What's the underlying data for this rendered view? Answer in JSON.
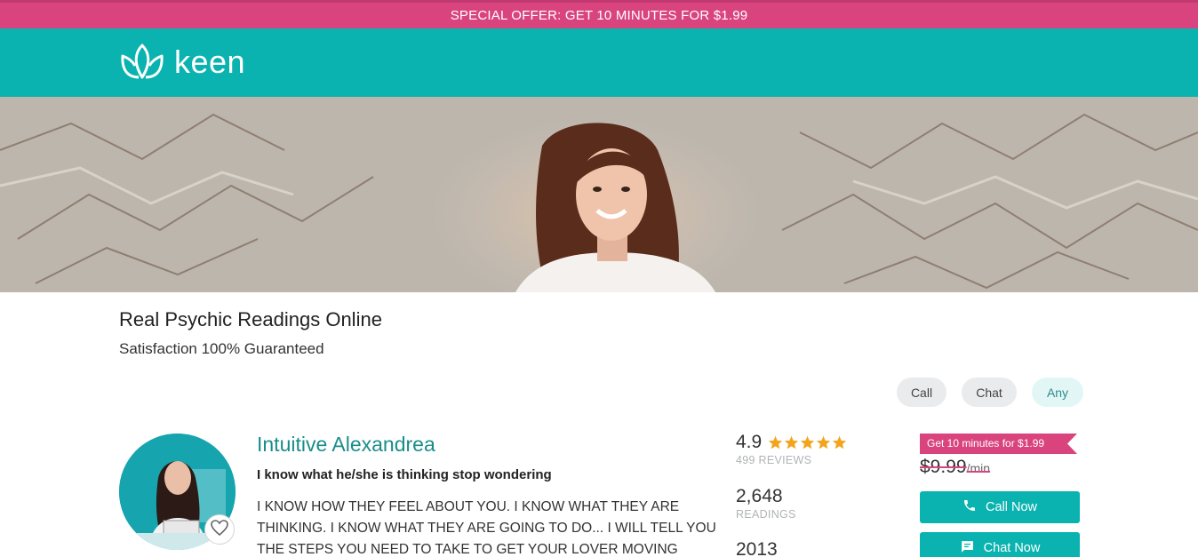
{
  "promo": {
    "text": "SPECIAL OFFER: GET 10 MINUTES FOR $1.99"
  },
  "brand": {
    "name": "keen",
    "accent": "#0ab3b0",
    "promo_color": "#d9447f"
  },
  "hero": {
    "image": "smiling-woman-banner"
  },
  "page": {
    "title": "Real Psychic Readings Online",
    "subtitle": "Satisfaction 100% Guaranteed"
  },
  "filters": [
    {
      "label": "Call"
    },
    {
      "label": "Chat"
    },
    {
      "label": "Any",
      "selected": true
    }
  ],
  "advisor": {
    "name": "Intuitive Alexandrea",
    "tagline": "I know what he/she is thinking stop wondering",
    "description": "I KNOW HOW THEY FEEL ABOUT YOU. I KNOW WHAT THEY ARE THINKING. I KNOW WHAT THEY ARE GOING TO DO... I WILL TELL YOU THE STEPS YOU NEED TO TAKE TO GET YOUR LOVER MOVING BACK IN",
    "rating": "4.9",
    "stars": 5,
    "reviews_label": "499 REVIEWS",
    "readings_value": "2,648",
    "readings_label": "READINGS",
    "since_value": "2013",
    "offer": "Get 10 minutes for $1.99",
    "price": "$9.99",
    "price_unit": "/min",
    "call_label": "Call Now",
    "chat_label": "Chat Now"
  },
  "icons": {
    "logo": "lotus-icon",
    "favorite": "heart-icon",
    "call": "phone-icon",
    "chat": "chat-bubble-icon",
    "rating": "star-icon"
  }
}
